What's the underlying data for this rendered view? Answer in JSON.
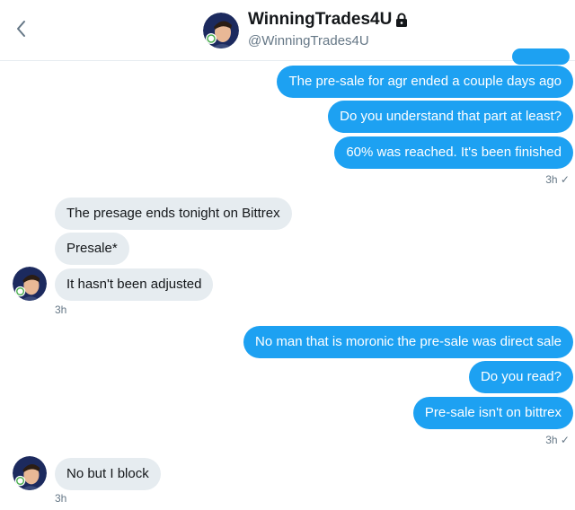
{
  "header": {
    "name": "WinningTrades4U",
    "handle": "@WinningTrades4U"
  },
  "icons": {
    "back": "chevron-left-icon",
    "lock": "lock-icon",
    "read": "check-icon"
  },
  "colors": {
    "outgoing_bubble": "#1da1f2",
    "incoming_bubble": "#e6ecf0",
    "meta_text": "#657786"
  },
  "conversation": {
    "group1": {
      "messages": [
        "The pre-sale for agr ended a couple days ago",
        "Do you understand that part at least?",
        "60% was reached. It's been finished"
      ],
      "time": "3h ✓"
    },
    "group2": {
      "messages": [
        "The presage ends tonight on Bittrex",
        "Presale*",
        "It hasn't been adjusted"
      ],
      "time": "3h"
    },
    "group3": {
      "messages": [
        "No man that is moronic the pre-sale was direct sale",
        "Do you read?",
        "Pre-sale isn't on bittrex"
      ],
      "time": "3h ✓"
    },
    "group4": {
      "messages": [
        "No but I block"
      ],
      "time": "3h"
    }
  }
}
